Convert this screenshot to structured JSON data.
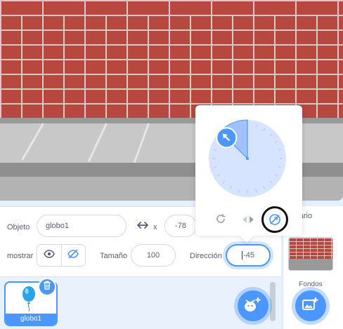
{
  "sprite_info": {
    "object_label": "Objeto",
    "sprite_name": "globo1",
    "x_label": "x",
    "x_value": "-78",
    "show_label": "mostrar",
    "size_label": "Tamaño",
    "size_value": "100",
    "direction_label": "Dirección",
    "direction_value": "-45"
  },
  "direction_popover": {
    "direction_degrees": -45,
    "modes": [
      "all-around-rotate-icon",
      "left-right-flip-icon",
      "dont-rotate-icon"
    ],
    "active_mode": "dont-rotate-icon"
  },
  "sprite_list": {
    "items": [
      {
        "name": "globo1",
        "selected": true
      }
    ]
  },
  "stage_panel": {
    "tab_label": "cenario",
    "backdrops_label": "Fondos"
  },
  "colors": {
    "accent": "#4c97ff",
    "text": "#575e75",
    "brick": "#b7483f"
  }
}
